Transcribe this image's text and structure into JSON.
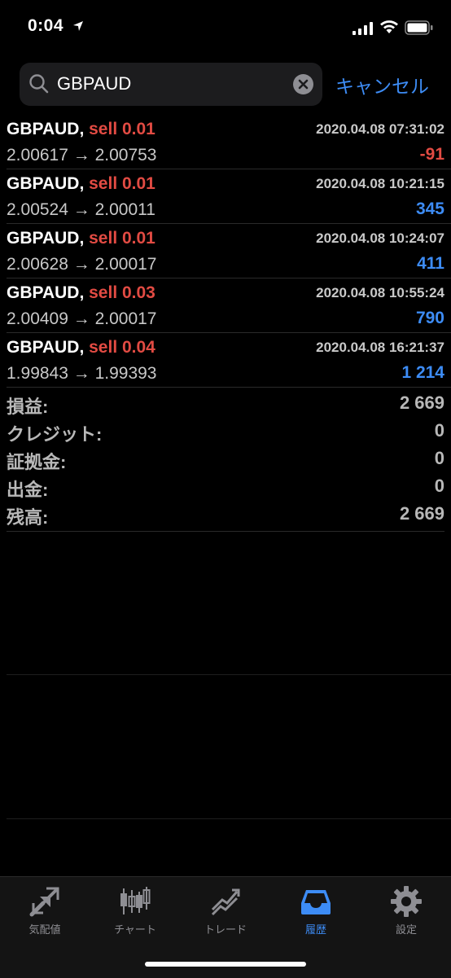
{
  "status": {
    "time": "0:04"
  },
  "search": {
    "value": "GBPAUD",
    "cancel_label": "キャンセル"
  },
  "colors": {
    "sell": "#e24b43",
    "positive": "#3d8cf5",
    "negative": "#e24b43",
    "accent": "#3d8cf5"
  },
  "trades": [
    {
      "symbol": "GBPAUD,",
      "side": "sell 0.01",
      "datetime": "2020.04.08 07:31:02",
      "prices": "2.00617 → 2.00753",
      "profit": "-91"
    },
    {
      "symbol": "GBPAUD,",
      "side": "sell 0.01",
      "datetime": "2020.04.08 10:21:15",
      "prices": "2.00524 → 2.00011",
      "profit": "345"
    },
    {
      "symbol": "GBPAUD,",
      "side": "sell 0.01",
      "datetime": "2020.04.08 10:24:07",
      "prices": "2.00628 → 2.00017",
      "profit": "411"
    },
    {
      "symbol": "GBPAUD,",
      "side": "sell 0.03",
      "datetime": "2020.04.08 10:55:24",
      "prices": "2.00409 → 2.00017",
      "profit": "790"
    },
    {
      "symbol": "GBPAUD,",
      "side": "sell 0.04",
      "datetime": "2020.04.08 16:21:37",
      "prices": "1.99843 → 1.99393",
      "profit": "1 214"
    }
  ],
  "summary": [
    {
      "label": "損益:",
      "value": "2 669"
    },
    {
      "label": "クレジット:",
      "value": "0"
    },
    {
      "label": "証拠金:",
      "value": "0"
    },
    {
      "label": "出金:",
      "value": "0"
    },
    {
      "label": "残高:",
      "value": "2 669"
    }
  ],
  "tabs": [
    {
      "label": "気配値",
      "icon": "quotes-icon",
      "active": false
    },
    {
      "label": "チャート",
      "icon": "chart-icon",
      "active": false
    },
    {
      "label": "トレード",
      "icon": "trade-icon",
      "active": false
    },
    {
      "label": "履歴",
      "icon": "history-icon",
      "active": true
    },
    {
      "label": "設定",
      "icon": "settings-icon",
      "active": false
    }
  ]
}
